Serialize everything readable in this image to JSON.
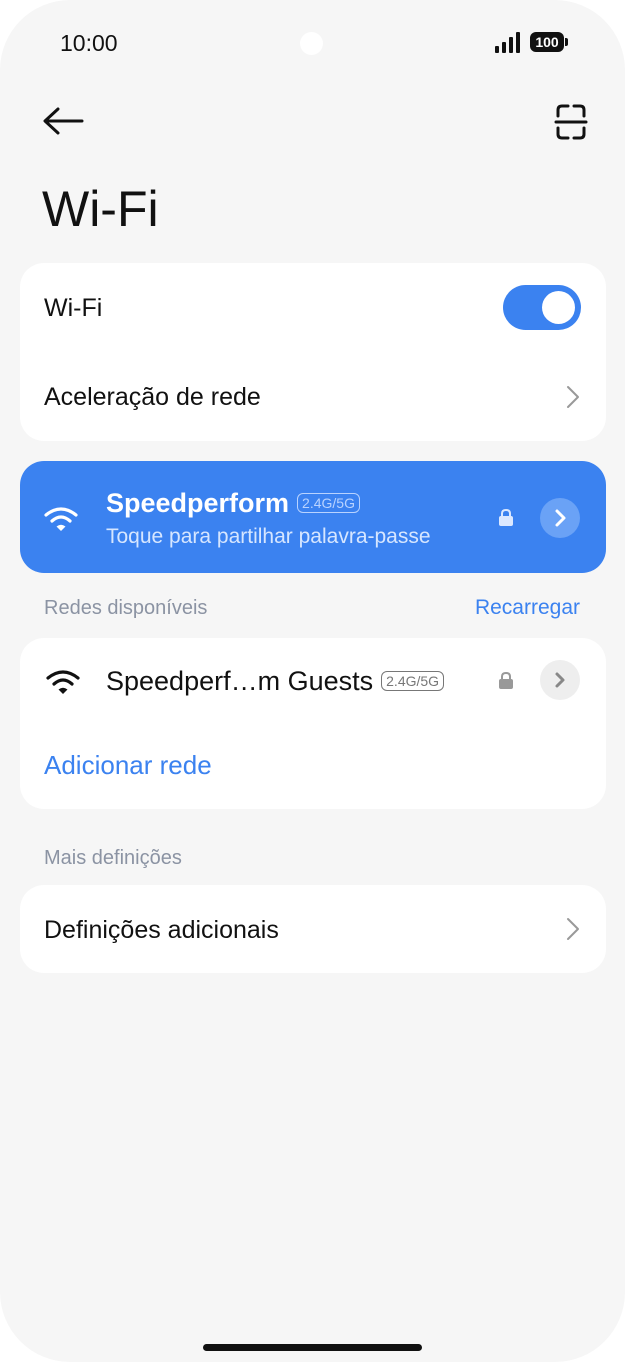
{
  "status": {
    "time": "10:00",
    "battery": "100"
  },
  "page": {
    "title": "Wi-Fi"
  },
  "wifi_card": {
    "wifi_label": "Wi-Fi",
    "wifi_enabled": true,
    "acceleration_label": "Aceleração de rede"
  },
  "connected_network": {
    "name": "Speedperform",
    "band": "2.4G/5G",
    "subtitle": "Toque para partilhar palavra-passe"
  },
  "available": {
    "section_label": "Redes disponíveis",
    "reload_label": "Recarregar",
    "networks": [
      {
        "name": "Speedperf…m Guests",
        "band": "2.4G/5G",
        "secured": true
      }
    ],
    "add_network_label": "Adicionar rede"
  },
  "more": {
    "section_label": "Mais definições",
    "additional_settings_label": "Definições adicionais"
  },
  "colors": {
    "accent": "#3b82f0",
    "background": "#f6f6f6",
    "card": "#ffffff"
  },
  "icons": [
    "back-arrow-icon",
    "scan-icon",
    "wifi-icon",
    "lock-icon",
    "chevron-right-icon",
    "signal-icon",
    "battery-icon"
  ]
}
